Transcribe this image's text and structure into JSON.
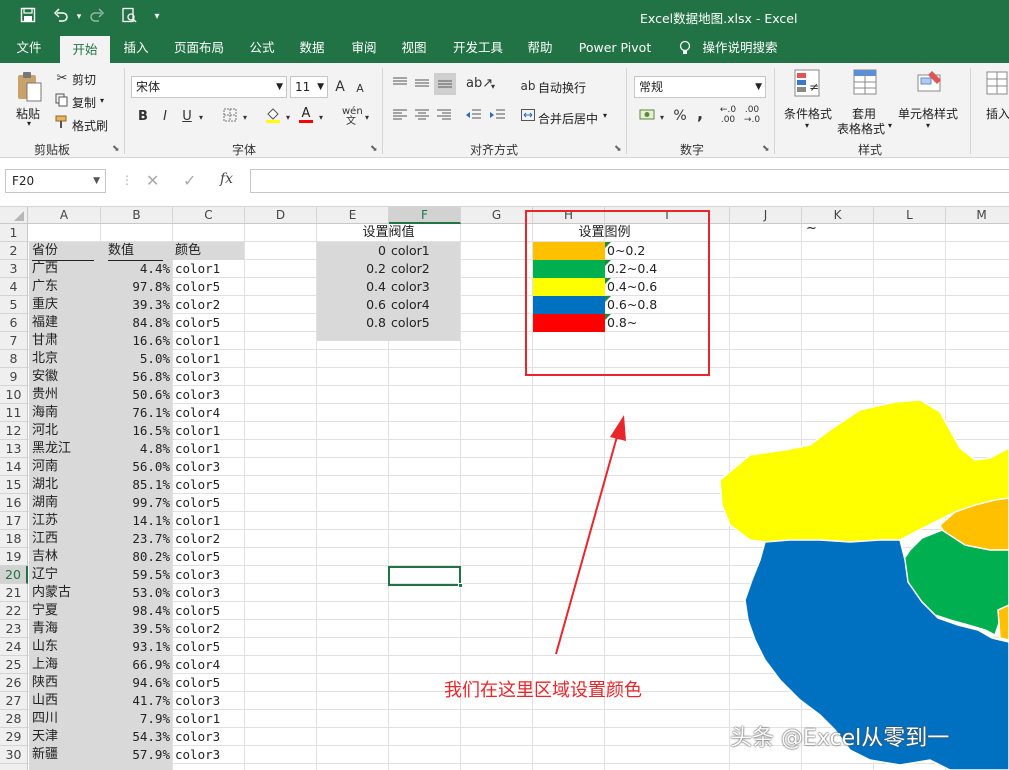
{
  "window": {
    "title": "Excel数据地图.xlsx  -  Excel"
  },
  "quick_access": {
    "customize": "▾"
  },
  "tabs": [
    "文件",
    "开始",
    "插入",
    "页面布局",
    "公式",
    "数据",
    "审阅",
    "视图",
    "开发工具",
    "帮助",
    "Power Pivot",
    "操作说明搜索"
  ],
  "ribbon": {
    "clipboard": {
      "paste": "粘贴",
      "cut": "剪切",
      "copy": "复制",
      "format_painter": "格式刷",
      "label": "剪贴板"
    },
    "font": {
      "name": "宋体",
      "size": "11",
      "increase": "A",
      "decrease": "A",
      "bold": "B",
      "italic": "I",
      "underline": "U",
      "font_color": "A",
      "label": "字体"
    },
    "alignment": {
      "wrap": "自动换行",
      "merge": "合并后居中",
      "label": "对齐方式"
    },
    "number": {
      "format": "常规",
      "percent": "%",
      "comma": ",",
      "label": "数字"
    },
    "styles": {
      "conditional": "条件格式",
      "table_1": "套用",
      "table_2": "表格格式",
      "cell_styles": "单元格样式",
      "label": "样式"
    },
    "cells": {
      "insert": "插入"
    }
  },
  "formula_bar": {
    "name_box": "F20",
    "fx": "fx",
    "formula": ""
  },
  "columns": [
    "A",
    "B",
    "C",
    "D",
    "E",
    "F",
    "G",
    "H",
    "I",
    "J",
    "K",
    "L",
    "M"
  ],
  "headers": {
    "A": "省份",
    "B": "数值",
    "C": "颜色"
  },
  "rows": [
    {
      "prov": "广西",
      "val": "4.4%",
      "color": "color1"
    },
    {
      "prov": "广东",
      "val": "97.8%",
      "color": "color5"
    },
    {
      "prov": "重庆",
      "val": "39.3%",
      "color": "color2"
    },
    {
      "prov": "福建",
      "val": "84.8%",
      "color": "color5"
    },
    {
      "prov": "甘肃",
      "val": "16.6%",
      "color": "color1"
    },
    {
      "prov": "北京",
      "val": "5.0%",
      "color": "color1"
    },
    {
      "prov": "安徽",
      "val": "56.8%",
      "color": "color3"
    },
    {
      "prov": "贵州",
      "val": "50.6%",
      "color": "color3"
    },
    {
      "prov": "海南",
      "val": "76.1%",
      "color": "color4"
    },
    {
      "prov": "河北",
      "val": "16.5%",
      "color": "color1"
    },
    {
      "prov": "黑龙江",
      "val": "4.8%",
      "color": "color1"
    },
    {
      "prov": "河南",
      "val": "56.0%",
      "color": "color3"
    },
    {
      "prov": "湖北",
      "val": "85.1%",
      "color": "color5"
    },
    {
      "prov": "湖南",
      "val": "99.7%",
      "color": "color5"
    },
    {
      "prov": "江苏",
      "val": "14.1%",
      "color": "color1"
    },
    {
      "prov": "江西",
      "val": "23.7%",
      "color": "color2"
    },
    {
      "prov": "吉林",
      "val": "80.2%",
      "color": "color5"
    },
    {
      "prov": "辽宁",
      "val": "59.5%",
      "color": "color3"
    },
    {
      "prov": "内蒙古",
      "val": "53.0%",
      "color": "color3"
    },
    {
      "prov": "宁夏",
      "val": "98.4%",
      "color": "color5"
    },
    {
      "prov": "青海",
      "val": "39.5%",
      "color": "color2"
    },
    {
      "prov": "山东",
      "val": "93.1%",
      "color": "color5"
    },
    {
      "prov": "上海",
      "val": "66.9%",
      "color": "color4"
    },
    {
      "prov": "陕西",
      "val": "94.6%",
      "color": "color5"
    },
    {
      "prov": "山西",
      "val": "41.7%",
      "color": "color3"
    },
    {
      "prov": "四川",
      "val": "7.9%",
      "color": "color1"
    },
    {
      "prov": "天津",
      "val": "54.3%",
      "color": "color3"
    },
    {
      "prov": "新疆",
      "val": "57.9%",
      "color": "color3"
    }
  ],
  "threshold": {
    "title": "设置阀值",
    "items": [
      {
        "value": "0",
        "name": "color1"
      },
      {
        "value": "0.2",
        "name": "color2"
      },
      {
        "value": "0.4",
        "name": "color3"
      },
      {
        "value": "0.6",
        "name": "color4"
      },
      {
        "value": "0.8",
        "name": "color5"
      }
    ]
  },
  "legend": {
    "title": "设置图例",
    "items": [
      {
        "range": "0~0.2",
        "color": "#ffc000"
      },
      {
        "range": "0.2~0.4",
        "color": "#00b050"
      },
      {
        "range": "0.4~0.6",
        "color": "#ffff00"
      },
      {
        "range": "0.6~0.8",
        "color": "#0070c0"
      },
      {
        "range": "0.8~",
        "color": "#ff0000"
      }
    ]
  },
  "k1_text": "~",
  "annotation": {
    "text": "我们在这里区域设置颜色",
    "color": "#e8262b"
  },
  "map_colors": {
    "yellow": "#ffff00",
    "orange": "#ffc000",
    "green": "#00b050",
    "blue": "#0070c0"
  },
  "watermark": "头条 @Excel从零到一",
  "selection_cell": "F20"
}
